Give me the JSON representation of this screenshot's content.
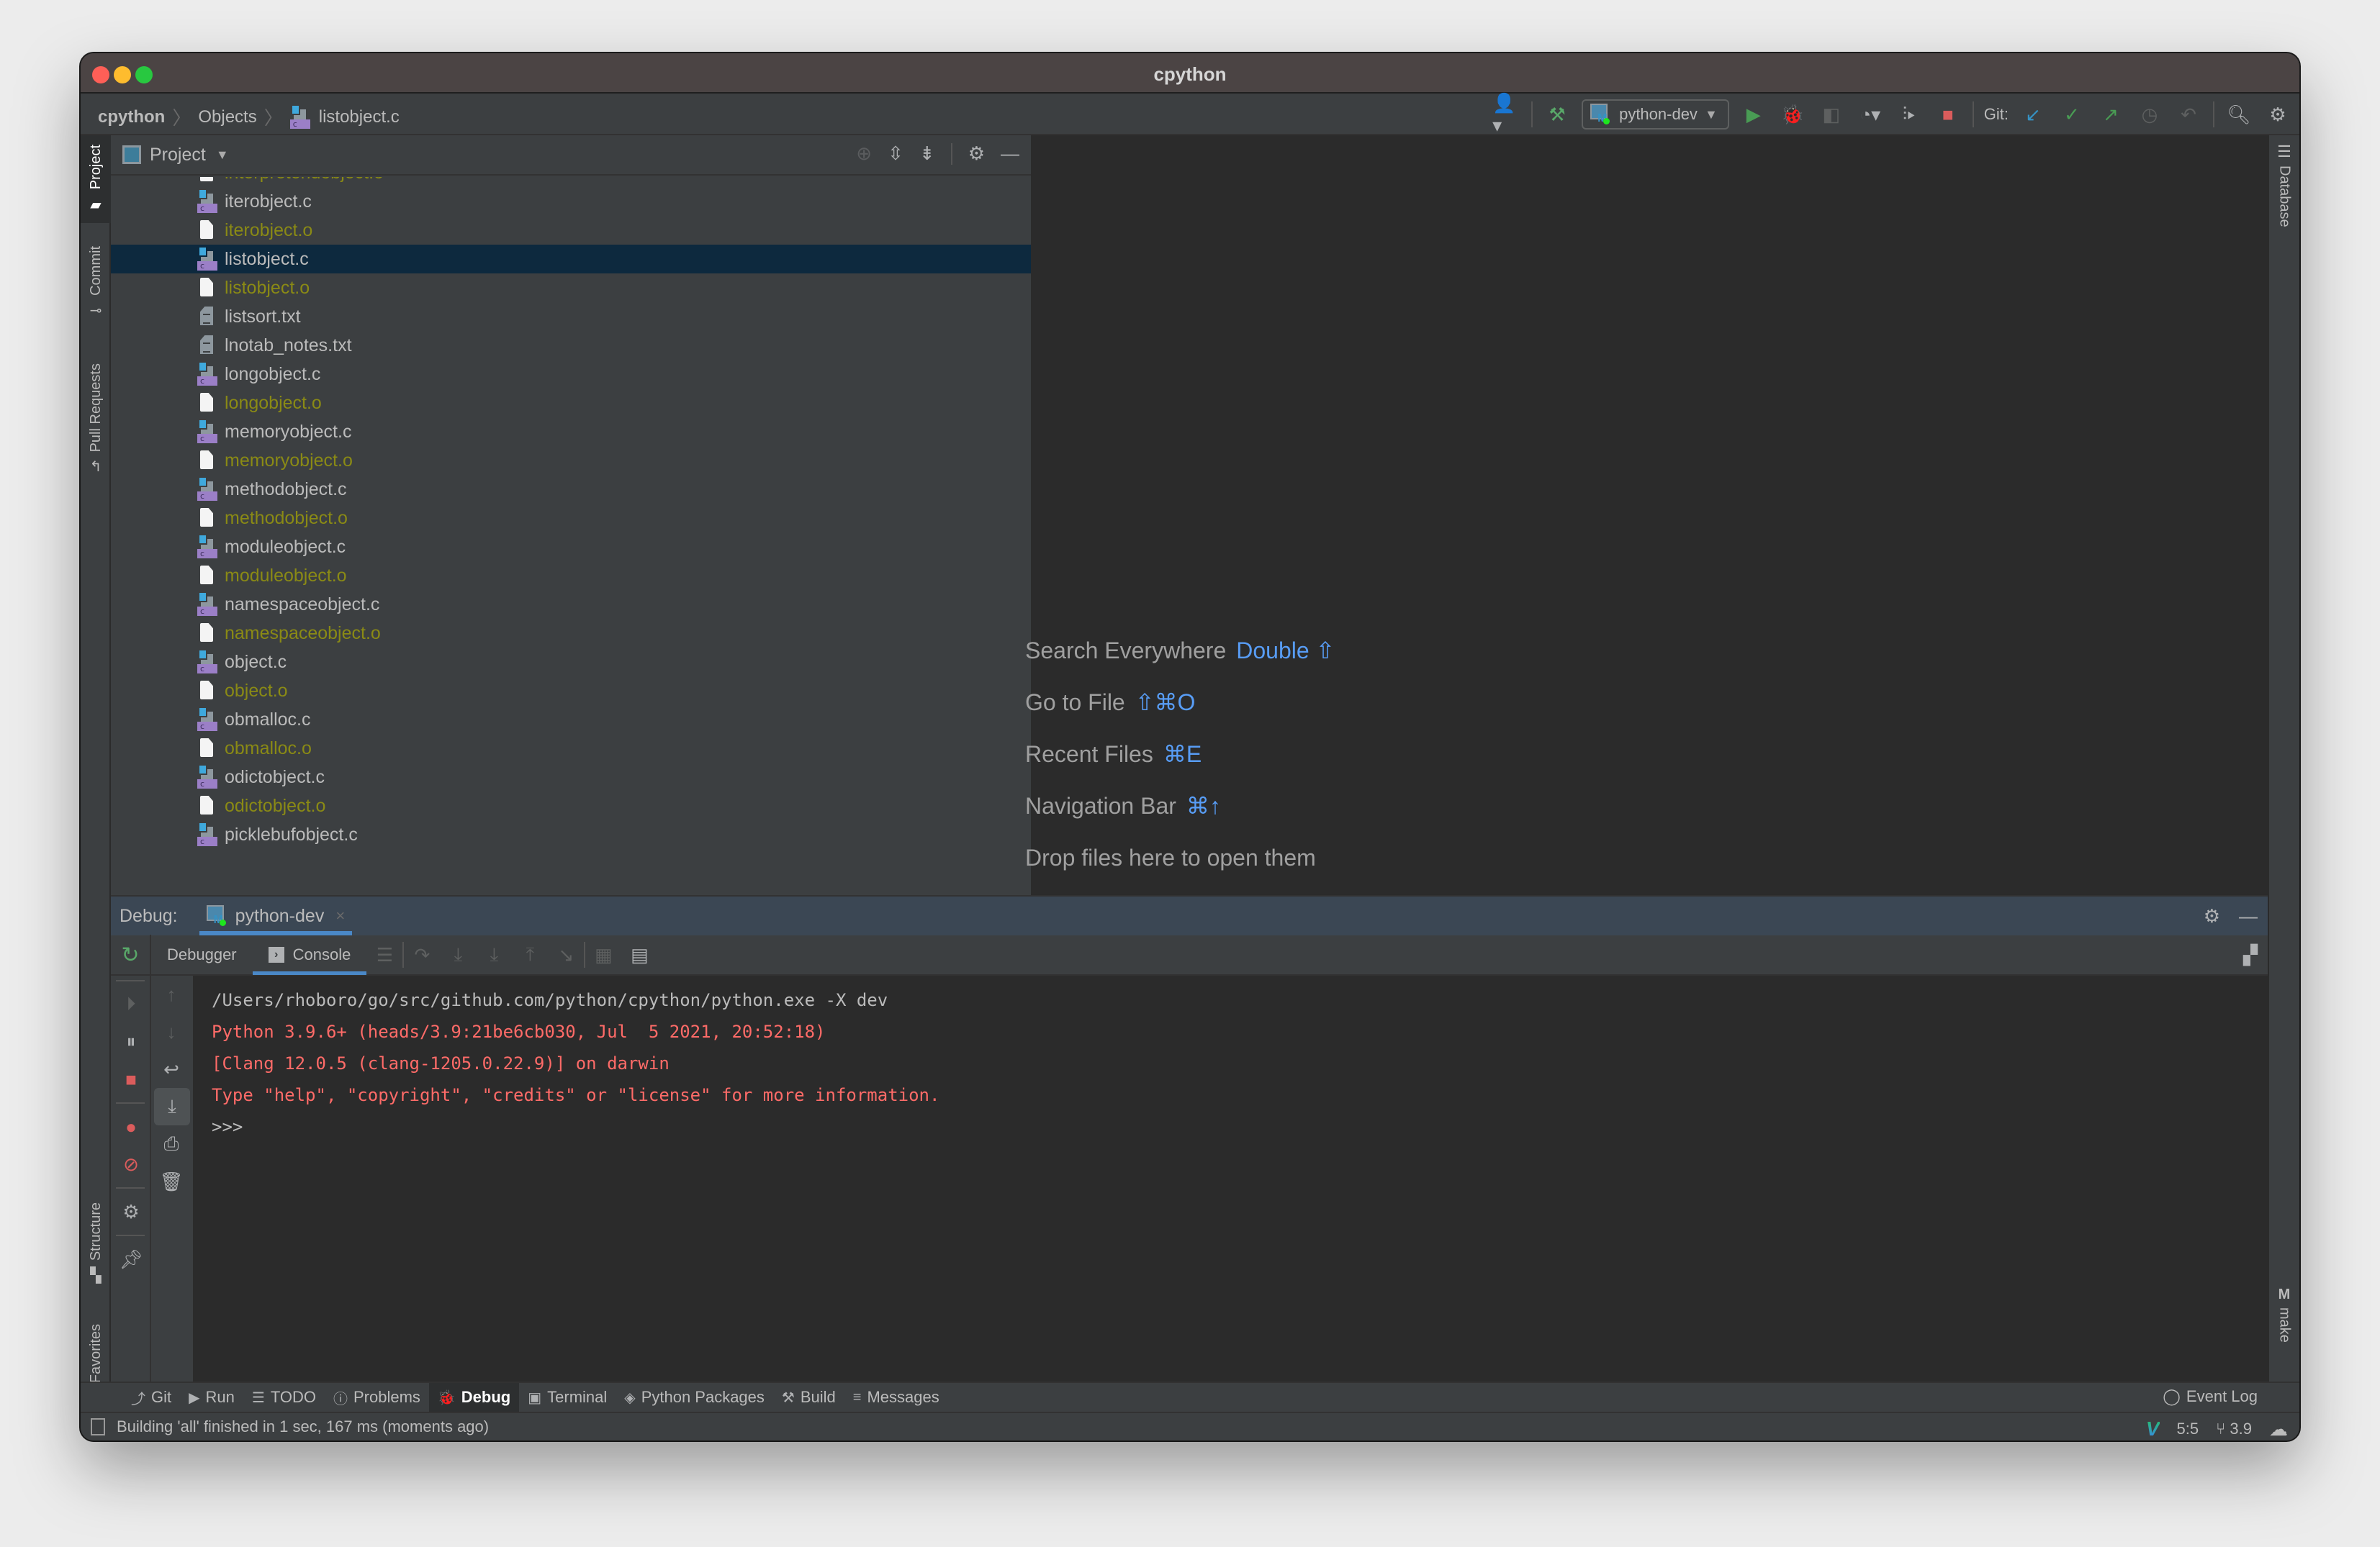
{
  "window": {
    "title": "cpython"
  },
  "breadcrumb": [
    "cpython",
    "Objects",
    "listobject.c"
  ],
  "toolbar": {
    "run_config": "python-dev",
    "git_label": "Git:"
  },
  "left_stripe": {
    "top": [
      {
        "label": "Project",
        "active": true
      },
      {
        "label": "Commit"
      },
      {
        "label": "Pull Requests"
      }
    ],
    "bottom": [
      {
        "label": "Structure"
      },
      {
        "label": "Favorites"
      }
    ]
  },
  "right_stripe": {
    "top": "Database",
    "bottom": "make"
  },
  "project_panel": {
    "title": "Project",
    "files": [
      {
        "name": "interpreteridobject.o",
        "type": "o",
        "partial": true
      },
      {
        "name": "iterobject.c",
        "type": "c"
      },
      {
        "name": "iterobject.o",
        "type": "o"
      },
      {
        "name": "listobject.c",
        "type": "c",
        "selected": true
      },
      {
        "name": "listobject.o",
        "type": "o"
      },
      {
        "name": "listsort.txt",
        "type": "txt"
      },
      {
        "name": "lnotab_notes.txt",
        "type": "txt"
      },
      {
        "name": "longobject.c",
        "type": "c"
      },
      {
        "name": "longobject.o",
        "type": "o"
      },
      {
        "name": "memoryobject.c",
        "type": "c"
      },
      {
        "name": "memoryobject.o",
        "type": "o"
      },
      {
        "name": "methodobject.c",
        "type": "c"
      },
      {
        "name": "methodobject.o",
        "type": "o"
      },
      {
        "name": "moduleobject.c",
        "type": "c"
      },
      {
        "name": "moduleobject.o",
        "type": "o"
      },
      {
        "name": "namespaceobject.c",
        "type": "c"
      },
      {
        "name": "namespaceobject.o",
        "type": "o"
      },
      {
        "name": "object.c",
        "type": "c"
      },
      {
        "name": "object.o",
        "type": "o"
      },
      {
        "name": "obmalloc.c",
        "type": "c"
      },
      {
        "name": "obmalloc.o",
        "type": "o"
      },
      {
        "name": "odictobject.c",
        "type": "c"
      },
      {
        "name": "odictobject.o",
        "type": "o"
      },
      {
        "name": "picklebufobject.c",
        "type": "c"
      }
    ]
  },
  "editor_hints": [
    {
      "label": "Search Everywhere",
      "shortcut": "Double ⇧"
    },
    {
      "label": "Go to File",
      "shortcut": "⇧⌘O"
    },
    {
      "label": "Recent Files",
      "shortcut": "⌘E"
    },
    {
      "label": "Navigation Bar",
      "shortcut": "⌘↑"
    },
    {
      "label": "Drop files here to open them",
      "shortcut": ""
    }
  ],
  "debug": {
    "label": "Debug:",
    "session_tab": "python-dev",
    "subtabs": [
      "Debugger",
      "Console"
    ],
    "active_subtab": "Console",
    "console_lines": [
      {
        "text": "/Users/rhoboro/go/src/github.com/python/cpython/python.exe -X dev",
        "kind": "cmd"
      },
      {
        "text": "Python 3.9.6+ (heads/3.9:21be6cb030, Jul  5 2021, 20:52:18)",
        "kind": "err"
      },
      {
        "text": "[Clang 12.0.5 (clang-1205.0.22.9)] on darwin",
        "kind": "err"
      },
      {
        "text": "Type \"help\", \"copyright\", \"credits\" or \"license\" for more information.",
        "kind": "err"
      },
      {
        "text": ">>>",
        "kind": "cmd"
      }
    ]
  },
  "bottom_tabs": [
    {
      "label": "Git",
      "icon": "git-icon"
    },
    {
      "label": "Run",
      "icon": "run-icon"
    },
    {
      "label": "TODO",
      "icon": "todo-icon"
    },
    {
      "label": "Problems",
      "icon": "problems-icon"
    },
    {
      "label": "Debug",
      "icon": "debug-icon",
      "active": true
    },
    {
      "label": "Terminal",
      "icon": "terminal-icon"
    },
    {
      "label": "Python Packages",
      "icon": "packages-icon"
    },
    {
      "label": "Build",
      "icon": "build-icon"
    },
    {
      "label": "Messages",
      "icon": "messages-icon"
    }
  ],
  "event_log": "Event Log",
  "status": {
    "message": "Building 'all' finished in 1 sec, 167 ms (moments ago)",
    "position": "5:5",
    "branch": "3.9"
  }
}
